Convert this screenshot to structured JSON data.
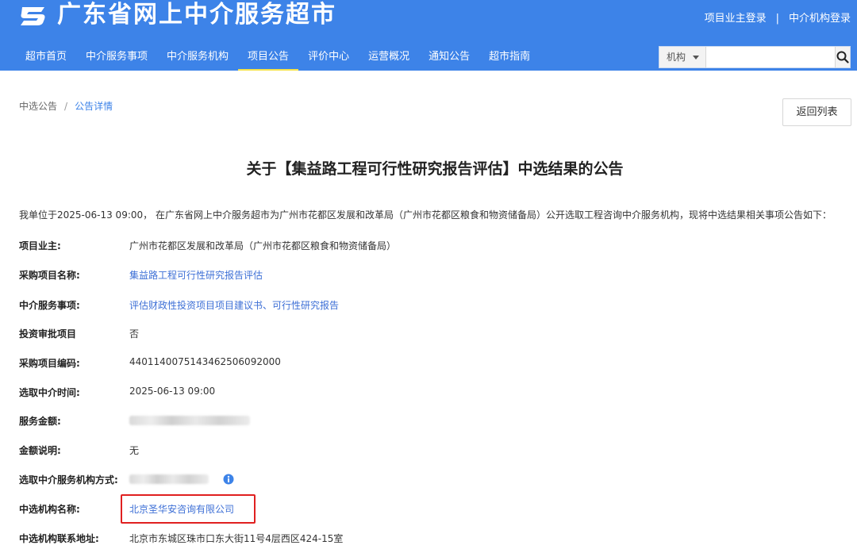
{
  "header": {
    "brand": "广东省网上中介服务超市",
    "owner_login": "项目业主登录",
    "separator": "|",
    "agency_login": "中介机构登录",
    "accent_color": "#3d83e8"
  },
  "nav": {
    "items": [
      {
        "label": "超市首页"
      },
      {
        "label": "中介服务事项"
      },
      {
        "label": "中介服务机构"
      },
      {
        "label": "项目公告"
      },
      {
        "label": "评价中心"
      },
      {
        "label": "运营概况"
      },
      {
        "label": "通知公告"
      },
      {
        "label": "超市指南"
      }
    ],
    "active_label": "项目公告"
  },
  "search": {
    "select_value": "机构",
    "placeholder": "",
    "value": ""
  },
  "breadcrumb": {
    "parent": "中选公告",
    "separator": "/",
    "current": "公告详情"
  },
  "back_button": "返回列表",
  "announcement": {
    "title": "关于【集益路工程可行性研究报告评估】中选结果的公告",
    "intro": "我单位于2025-06-13 09:00， 在广东省网上中介服务超市为广州市花都区发展和改革局（广州市花都区粮食和物资储备局）公开选取工程咨询中介服务机构，现将中选结果相关事项公告如下：",
    "fields": [
      {
        "label": "项目业主:",
        "value": "广州市花都区发展和改革局（广州市花都区粮食和物资储备局）"
      },
      {
        "label": "采购项目名称:",
        "value": "集益路工程可行性研究报告评估"
      },
      {
        "label": "中介服务事项:",
        "value": "评估财政性投资项目项目建议书、可行性研究报告"
      },
      {
        "label": "投资审批项目",
        "value": "否"
      },
      {
        "label": "采购项目编码:",
        "value": "440114007514346250609​2000"
      },
      {
        "label": "选取中介时间:",
        "value": "2025-06-13 09:00"
      },
      {
        "label": "服务金额:",
        "value": ""
      },
      {
        "label": "金额说明:",
        "value": "无"
      },
      {
        "label": "选取中介服务机构方式:",
        "value": ""
      },
      {
        "label": "中选机构名称:",
        "value": "北京圣华安咨询有限公司"
      },
      {
        "label": "中选机构联系地址:",
        "value": "北京市东城区珠市口东大街11号4层西区424-15室"
      }
    ]
  }
}
